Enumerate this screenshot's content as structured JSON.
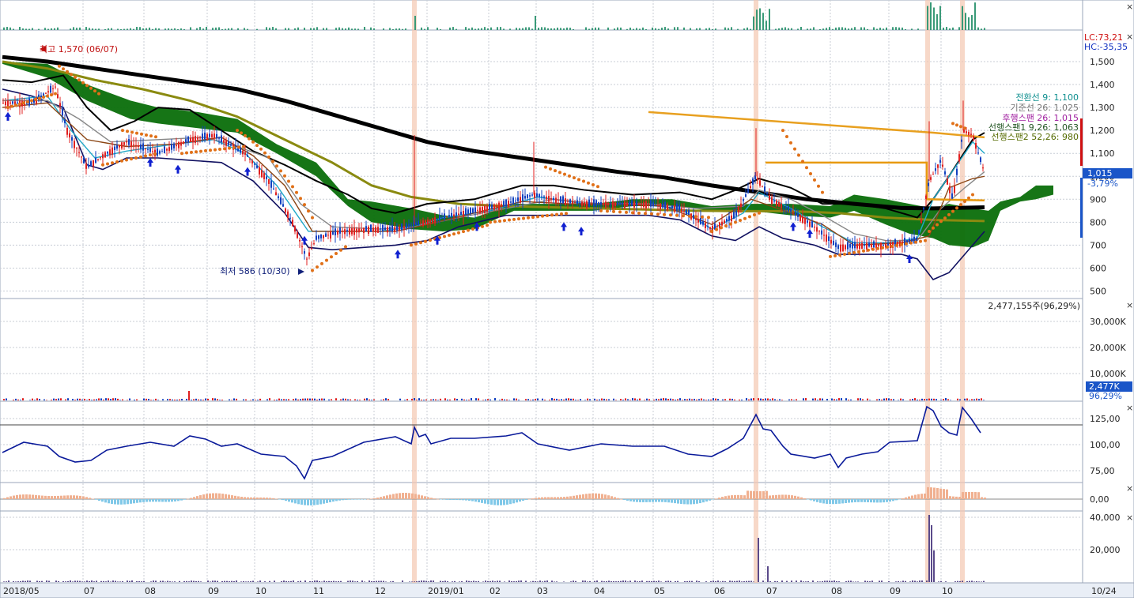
{
  "annotations": {
    "high": "최고 1,570 (06/07)",
    "low": "최저 586 (10/30)"
  },
  "right_panel": {
    "lc": "LC:73,21",
    "hc": "HC:-35,35",
    "price": "1,015",
    "change": "-3,79%",
    "volume_info": "2,477,155주(96,29%)",
    "volume_badge": "2,477K",
    "volume_pct": "96,29%",
    "date": "10/24"
  },
  "ichimoku_legend": [
    {
      "label": "전환선 9: 1,100",
      "color": "#0f8f8f"
    },
    {
      "label": "기준선 26: 1,025",
      "color": "#777777"
    },
    {
      "label": "후행스팬 26: 1,015",
      "color": "#a020a0"
    },
    {
      "label": "선행스팬1 9,26: 1,063",
      "color": "#225522"
    },
    {
      "label": "선행스팬2 52,26: 980",
      "color": "#556b00"
    }
  ],
  "price_axis": [
    "1,500",
    "1,400",
    "1,300",
    "1,200",
    "1,100",
    "1,000",
    "900",
    "800",
    "700",
    "600",
    "500"
  ],
  "volume_axis": [
    "30,000K",
    "20,000K",
    "10,000K"
  ],
  "osc1_axis": [
    "125,00",
    "100,00",
    "75,00"
  ],
  "osc2_axis": [
    "0,00"
  ],
  "osc3_axis": [
    "40,000",
    "20,000"
  ],
  "x_labels": [
    "2018/05",
    "07",
    "08",
    "09",
    "10",
    "11",
    "12",
    "2019/01",
    "02",
    "03",
    "04",
    "05",
    "06",
    "07",
    "08",
    "09",
    "10"
  ],
  "colors": {
    "up": "#e02020",
    "down": "#1040c0",
    "cloud": "#0a6e0a",
    "ma_long": "#000000",
    "ma_mid": "#8a8a10",
    "trend": "#e8a020",
    "sar": "#e07018",
    "bollinger": "#101060",
    "highlight": "#f4c8b0",
    "volume_top": "#3a9a78",
    "osc_pos": "#f0b090",
    "osc_neg": "#80c8e8",
    "histogram": "#5a4a8a"
  }
}
